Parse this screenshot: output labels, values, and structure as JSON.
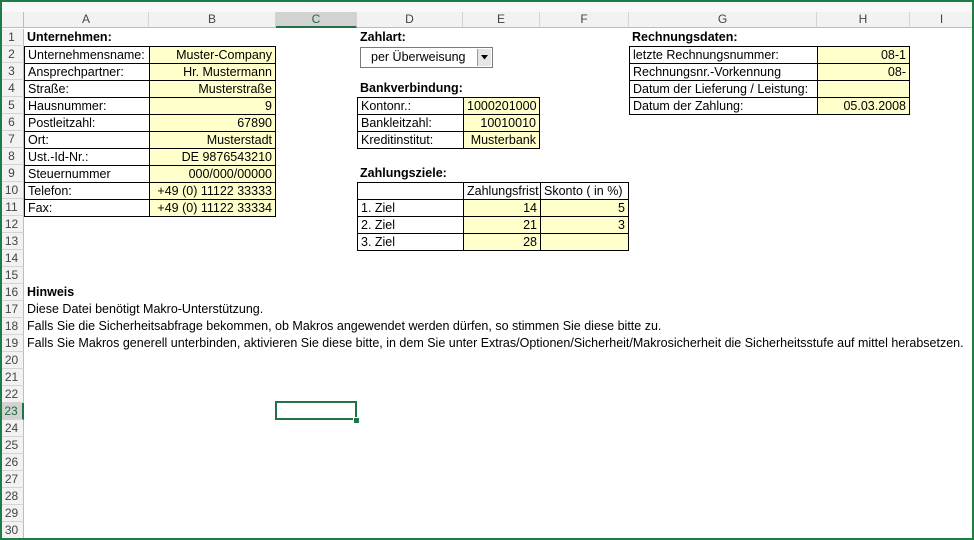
{
  "columns": [
    "A",
    "B",
    "C",
    "D",
    "E",
    "F",
    "G",
    "H",
    "I"
  ],
  "rows": [
    "1",
    "2",
    "3",
    "4",
    "5",
    "6",
    "7",
    "8",
    "9",
    "10",
    "11",
    "12",
    "13",
    "14",
    "15",
    "16",
    "17",
    "18",
    "19",
    "20",
    "21",
    "22",
    "23",
    "24",
    "25",
    "26",
    "27",
    "28",
    "29",
    "30"
  ],
  "active_column": "C",
  "active_row": "23",
  "company": {
    "header": "Unternehmen:",
    "fields": [
      {
        "label": "Unternehmensname:",
        "value": "Muster-Company"
      },
      {
        "label": "Ansprechpartner:",
        "value": "Hr. Mustermann"
      },
      {
        "label": "Straße:",
        "value": "Musterstraße"
      },
      {
        "label": "Hausnummer:",
        "value": "9"
      },
      {
        "label": "Postleitzahl:",
        "value": "67890"
      },
      {
        "label": "Ort:",
        "value": "Musterstadt"
      },
      {
        "label": "Ust.-Id-Nr.:",
        "value": "DE 9876543210"
      },
      {
        "label": "Steuernummer",
        "value": "000/000/00000"
      },
      {
        "label": "Telefon:",
        "value": "+49 (0) 11122 33333"
      },
      {
        "label": "Fax:",
        "value": "+49 (0) 11122 33334"
      }
    ]
  },
  "payment": {
    "header": "Zahlart:",
    "selected": "per Überweisung"
  },
  "bank": {
    "header": "Bankverbindung:",
    "fields": [
      {
        "label": "Kontonr.:",
        "value": "1000201000"
      },
      {
        "label": "Bankleitzahl:",
        "value": "10010010"
      },
      {
        "label": "Kreditinstitut:",
        "value": "Musterbank"
      }
    ]
  },
  "terms": {
    "header": "Zahlungsziele:",
    "col1": "Zahlungsfrist",
    "col2": "Skonto ( in %)",
    "rows": [
      {
        "label": "1. Ziel",
        "frist": "14",
        "skonto": "5"
      },
      {
        "label": "2. Ziel",
        "frist": "21",
        "skonto": "3"
      },
      {
        "label": "3. Ziel",
        "frist": "28",
        "skonto": ""
      }
    ]
  },
  "invoice": {
    "header": "Rechnungsdaten:",
    "fields": [
      {
        "label": "letzte Rechnungsnummer:",
        "value": "08-1"
      },
      {
        "label": "Rechnungsnr.-Vorkennung",
        "value": "08-"
      },
      {
        "label": "Datum der Lieferung / Leistung:",
        "value": ""
      },
      {
        "label": "Datum der Zahlung:",
        "value": "05.03.2008"
      }
    ]
  },
  "note": {
    "header": "Hinweis",
    "lines": [
      "Diese Datei benötigt Makro-Unterstützung.",
      "Falls Sie die Sicherheitsabfrage bekommen, ob Makros angewendet werden dürfen, so stimmen Sie diese bitte zu.",
      "Falls Sie Makros generell unterbinden, aktivieren Sie diese bitte, in dem Sie unter Extras/Optionen/Sicherheit/Makrosicherheit die Sicherheitsstufe auf mittel herabsetzen."
    ]
  }
}
